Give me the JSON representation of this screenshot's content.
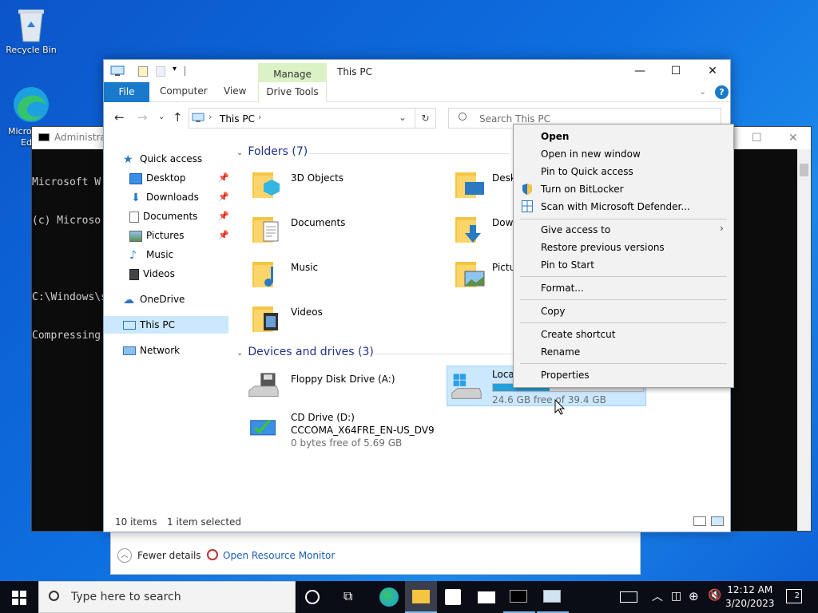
{
  "desktop": {
    "recycle_bin": "Recycle Bin",
    "edge_label_a": "Micro",
    "edge_label_b": "Ed"
  },
  "cmd": {
    "title": "Administra",
    "lines": [
      "Microsoft W",
      "(c) Microso",
      "",
      "C:\\Windows\\s",
      "Compressing"
    ]
  },
  "task_manager": {
    "fewer_details": "Fewer details",
    "open_resource_monitor": "Open Resource Monitor"
  },
  "explorer": {
    "context_tab": "Manage",
    "title": "This PC",
    "ribbon_tabs": {
      "file": "File",
      "computer": "Computer",
      "view": "View",
      "drive_tools": "Drive Tools"
    },
    "address": "This PC",
    "search_placeholder": "Search This PC",
    "nav": {
      "quick_access": "Quick access",
      "desktop": "Desktop",
      "downloads": "Downloads",
      "documents": "Documents",
      "pictures": "Pictures",
      "music": "Music",
      "videos": "Videos",
      "onedrive": "OneDrive",
      "this_pc": "This PC",
      "network": "Network"
    },
    "groups": {
      "folders": "Folders (7)",
      "devices": "Devices and drives (3)"
    },
    "folders": [
      "3D Objects",
      "Documents",
      "Music",
      "Videos",
      "Deskt",
      "Down",
      "Pictu"
    ],
    "drives": {
      "floppy": "Floppy Disk Drive (A:)",
      "local_label": "Local",
      "local_free": "24.6 GB free of 39.4 GB",
      "local_used_fraction": 0.376,
      "cd_label": "CD Drive (D:)",
      "cd_volume": "CCCOMA_X64FRE_EN-US_DV9",
      "cd_free": "0 bytes free of 5.69 GB"
    },
    "status": {
      "items": "10 items",
      "selected": "1 item selected"
    }
  },
  "context_menu": {
    "open": "Open",
    "open_new_window": "Open in new window",
    "pin_quick_access": "Pin to Quick access",
    "bitlocker": "Turn on BitLocker",
    "defender": "Scan with Microsoft Defender...",
    "give_access": "Give access to",
    "restore": "Restore previous versions",
    "pin_start": "Pin to Start",
    "format": "Format...",
    "copy": "Copy",
    "create_shortcut": "Create shortcut",
    "rename": "Rename",
    "properties": "Properties"
  },
  "taskbar": {
    "search_placeholder": "Type here to search",
    "time": "12:12 AM",
    "date": "3/20/2023",
    "notification_count": "2"
  },
  "colors": {
    "accent": "#1979ca",
    "selection": "#cce8ff",
    "folder": "#f5c542"
  }
}
